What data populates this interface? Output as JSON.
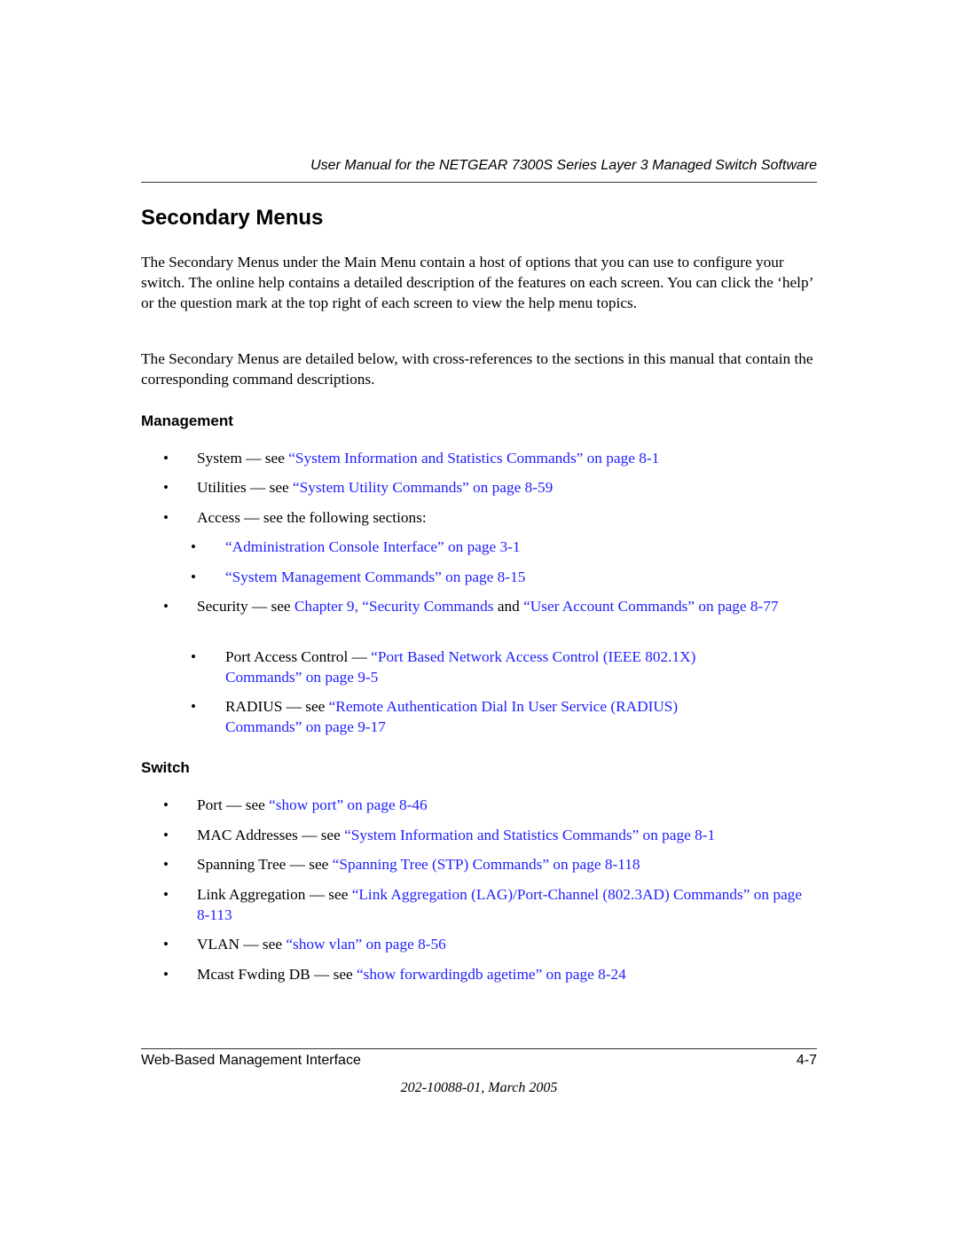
{
  "header": {
    "running_title": "User Manual for the NETGEAR 7300S Series Layer 3 Managed Switch Software"
  },
  "section": {
    "title": "Secondary Menus",
    "paragraphs": [
      "The Secondary Menus under the Main Menu contain a host of options that you can use to configure your switch. The online help contains a detailed description of the features on each screen. You can click the ‘help’ or the question mark at the top right of each screen to view the help menu topics.",
      "The Secondary Menus are detailed below, with cross-references to the sections in this manual that contain the corresponding command descriptions."
    ]
  },
  "management": {
    "heading": "Management",
    "items": [
      {
        "label": "System — see ",
        "link": "“System Information and Statistics Commands” on page 8-1"
      },
      {
        "label": "Utilities — see ",
        "link": "“System Utility Commands” on page 8-59"
      },
      {
        "label": "Access — see the following sections:"
      },
      {
        "link": "“Administration Console Interface” on page 3-1"
      },
      {
        "link": "“System Management Commands” on page 8-15"
      },
      {
        "label": "Security — see ",
        "link": "Chapter 9, “Security Commands",
        "mid": " and ",
        "link2": "“User Account Commands” on page 8-77"
      },
      {
        "label": "Port Access Control — ",
        "link": "“Port Based Network Access Control (IEEE 802.1X) Commands” on page 9-5"
      },
      {
        "label": "RADIUS — see ",
        "link": "“Remote Authentication Dial In User Service (RADIUS) Commands” on page 9-17"
      }
    ]
  },
  "switch": {
    "heading": "Switch",
    "items": [
      {
        "label": "Port — see ",
        "link": "“show port” on page 8-46"
      },
      {
        "label": "MAC Addresses — see ",
        "link": "“System Information and Statistics Commands” on page 8-1"
      },
      {
        "label": "Spanning Tree — see ",
        "link": "“Spanning Tree (STP) Commands” on page 8-118"
      },
      {
        "label": "Link Aggregation — see ",
        "link": "“Link Aggregation (LAG)/Port-Channel (802.3AD) Commands” on page 8-113"
      },
      {
        "label": "VLAN — see ",
        "link": "“show vlan” on page 8-56"
      },
      {
        "label": "Mcast Fwding DB — see ",
        "link": "“show forwardingdb agetime” on page 8-24"
      }
    ]
  },
  "footer": {
    "chapter": "Web-Based Management Interface",
    "page_number": "4-7",
    "doc_id": "202-10088-01, March 2005"
  },
  "colors": {
    "link": "#1f1fff",
    "text": "#000000"
  }
}
